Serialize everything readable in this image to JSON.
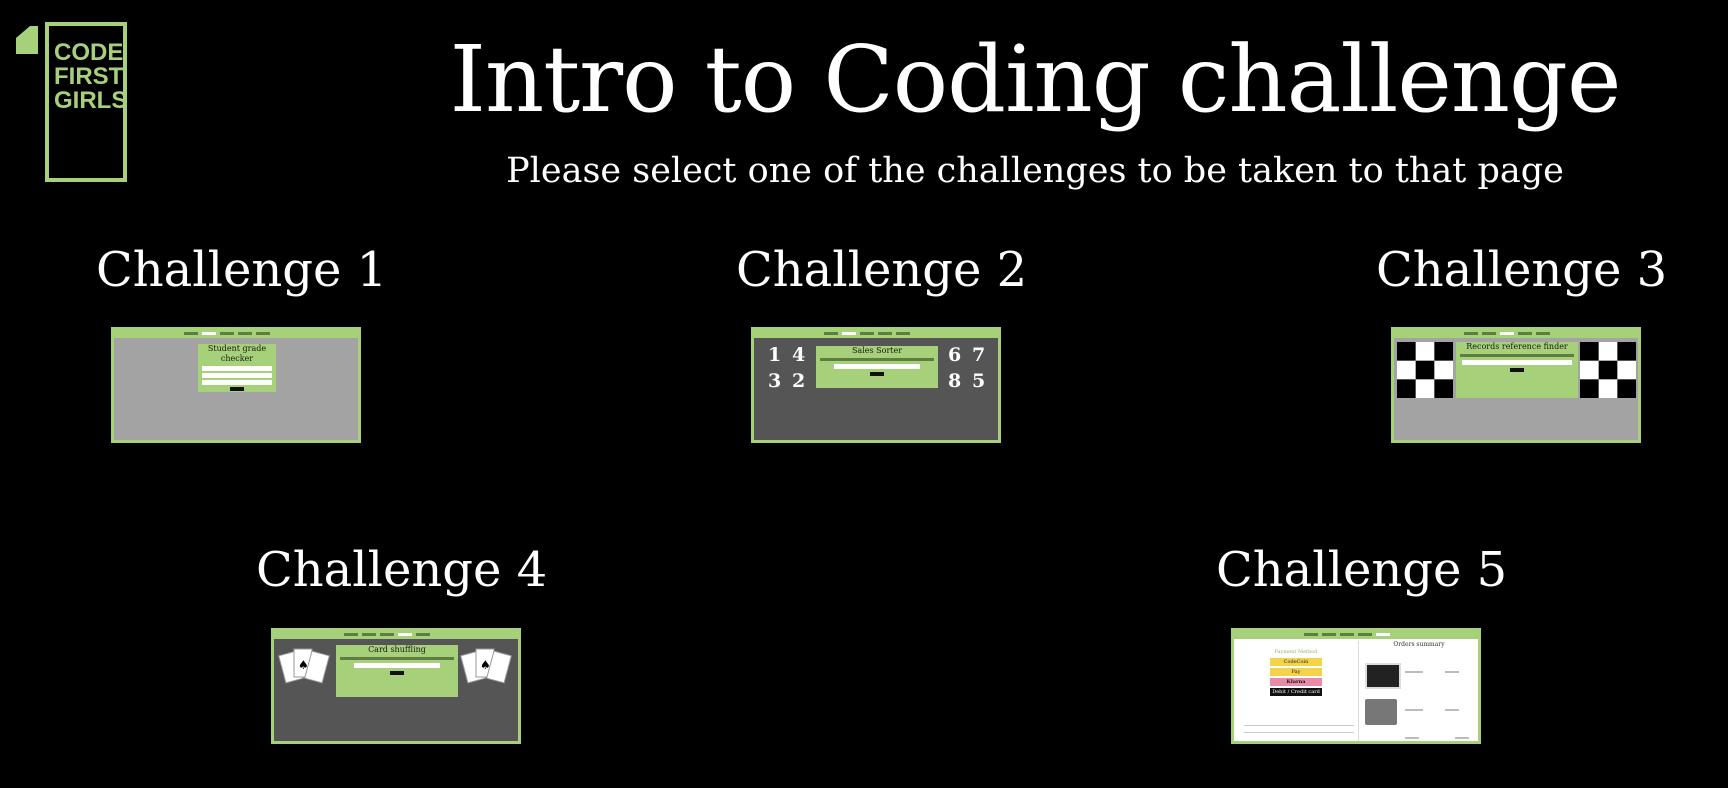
{
  "header": {
    "logo_text": "CODE FIRST GIRLS",
    "title": "Intro to Coding challenge",
    "subtitle": "Please select one of the challenges to be taken to that page"
  },
  "challenges": [
    {
      "label": "Challenge 1",
      "preview_title": "Student grade checker"
    },
    {
      "label": "Challenge 2",
      "preview_title": "Sales Sorter",
      "preview_numbers": [
        "1",
        "4",
        "3",
        "2",
        "6",
        "7",
        "8",
        "5"
      ]
    },
    {
      "label": "Challenge 3",
      "preview_title": "Records reference finder"
    },
    {
      "label": "Challenge 4",
      "preview_title": "Card shuffling"
    },
    {
      "label": "Challenge 5",
      "preview_title": "Orders summary",
      "preview_payments": [
        "Payment Method",
        "CodeCoin",
        "Pay",
        "Klarna",
        "Debit / Credit card"
      ]
    }
  ],
  "colors": {
    "background": "#000000",
    "accent": "#a6d17a",
    "text": "#ffffff"
  }
}
